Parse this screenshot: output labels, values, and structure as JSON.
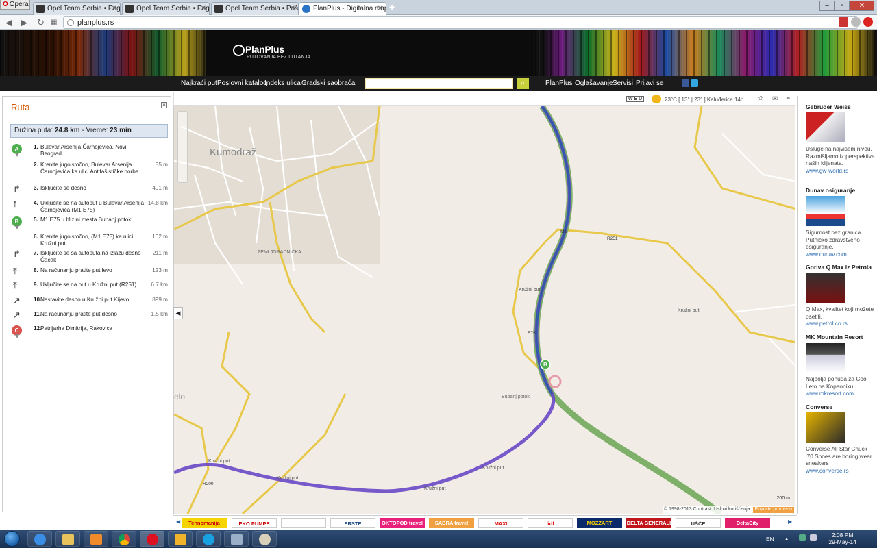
{
  "browser": {
    "menu_label": "Opera",
    "tabs": [
      {
        "title": "Opel Team Serbia • Pogled"
      },
      {
        "title": "Opel Team Serbia • Pogled"
      },
      {
        "title": "Opel Team Serbia • Pošalj"
      },
      {
        "title": "PlanPlus - Digitalna mapa"
      }
    ],
    "url": "planplus.rs"
  },
  "header": {
    "logo_text": "PlanPlus",
    "tagline": "PUTOVANJA BEZ LUTANJA"
  },
  "menu": {
    "left_items": [
      "Najkraći put",
      "Poslovni katalog",
      "Indeks ulica",
      "Gradski saobraćaj"
    ],
    "right_items": [
      "PlanPlus",
      "Oglašavanje",
      "Servisi",
      "Prijavi se"
    ]
  },
  "map_toolbar": {
    "weather_brand": "W E U",
    "weather_text": "23°C [ 13° | 23° ] Kaluđerica 14h"
  },
  "route": {
    "title": "Ruta",
    "summary_length_label": "Dužina puta:",
    "summary_length": "24.8 km",
    "summary_time_label": "- Vreme:",
    "summary_time": "23 min",
    "steps": [
      {
        "num": "1.",
        "text": "Bulevar Arsenija Čarnojevića, Novi Beograd",
        "dist": "",
        "icon": "start-pin"
      },
      {
        "num": "2.",
        "text": "Krenite jugoistočno, Bulevar Arsenija Čarnojevića ka ulici Antifašističke borbe",
        "dist": "55 m",
        "icon": "none"
      },
      {
        "num": "3.",
        "text": "Isključite se desno",
        "dist": "401 m",
        "icon": "turn-right"
      },
      {
        "num": "4.",
        "text": "Uključite se na autoput u Bulevar Arsenija Čarnojevića (M1 E75)",
        "dist": "14.8 km",
        "icon": "merge"
      },
      {
        "num": "5.",
        "text": "M1 E75 u blizini mesta Bubanj potok",
        "dist": "",
        "icon": "waypoint-pin"
      },
      {
        "num": "6.",
        "text": "Krenite jugoistočno, (M1 E75) ka ulici Kružni put",
        "dist": "102 m",
        "icon": "none"
      },
      {
        "num": "7.",
        "text": "Isključite se sa autoputa na izlazu desno Čačak",
        "dist": "211 m",
        "icon": "turn-right"
      },
      {
        "num": "8.",
        "text": "Na računanju pratite put levo",
        "dist": "123 m",
        "icon": "merge"
      },
      {
        "num": "9.",
        "text": "Uključite se na put u Kružni put (R251)",
        "dist": "6.7 km",
        "icon": "merge"
      },
      {
        "num": "10.",
        "text": "Nastavite desno u Kružni put Kijevo",
        "dist": "899 m",
        "icon": "bear-right"
      },
      {
        "num": "11.",
        "text": "Na računanju pratite put desno",
        "dist": "1.5 km",
        "icon": "bear-right"
      },
      {
        "num": "12.",
        "text": "Patrijarha Dimitrija, Rakovica",
        "dist": "",
        "icon": "end-pin"
      }
    ]
  },
  "map": {
    "labels": {
      "kumodraz": "Kumodraž",
      "zemljoradnicka": "ZEMLJORADNIČKA",
      "bubanj": "Bubanj potok",
      "kruzni_1": "Kružni put",
      "kruzni_2": "Kružni put",
      "kruzni_3": "Kružni put",
      "kruzni_4": "Kružni put",
      "kruzni_5": "Kružni put",
      "kruzni_6": "Kružni put",
      "r251": "R251",
      "r200": "R200",
      "e75": "E75",
      "m1": "M1",
      "elo": "elo"
    },
    "scale": "200 m",
    "copyright": "© 1998-2013 Contrast",
    "terms": "Uslovi korišćenja",
    "report": "Prijavite promenu"
  },
  "ads": [
    {
      "title": "Gebrüder Weiss",
      "text": "Usluge na najvišem nivou. Razmišljamo iz perspektive naših klijenata.",
      "url": "www.gw-world.rs"
    },
    {
      "title": "Dunav osiguranje",
      "text": "Sigurnost bez granica. Putničko zdravstveno osiguranje.",
      "url": "www.dunav.com"
    },
    {
      "title": "Goriva Q Max iz Petrola",
      "text": "Q Max, kvalitet koji možete osetiti.",
      "url": "www.petrol.co.rs"
    },
    {
      "title": "MK Mountain Resort",
      "text": "Najbolja ponuda za Cool Leto na Kopaoniku!",
      "url": "www.mkresort.com"
    },
    {
      "title": "Converse",
      "text": "Converse All Star Chuck '70 Shoes are boring wear sneakers",
      "url": "www.converse.rs"
    }
  ],
  "sponsors": [
    "Tehnomanija",
    "EKO PUMPE",
    "",
    "ERSTE",
    "OKTOPOD travel",
    "SABRA travel",
    "MAXI",
    "lidl",
    "MOZZART",
    "DELTA GENERALI",
    "UŠĆE",
    "DeltaCity"
  ],
  "taskbar": {
    "lang": "EN",
    "time": "2:08 PM",
    "date": "29-May-14"
  }
}
